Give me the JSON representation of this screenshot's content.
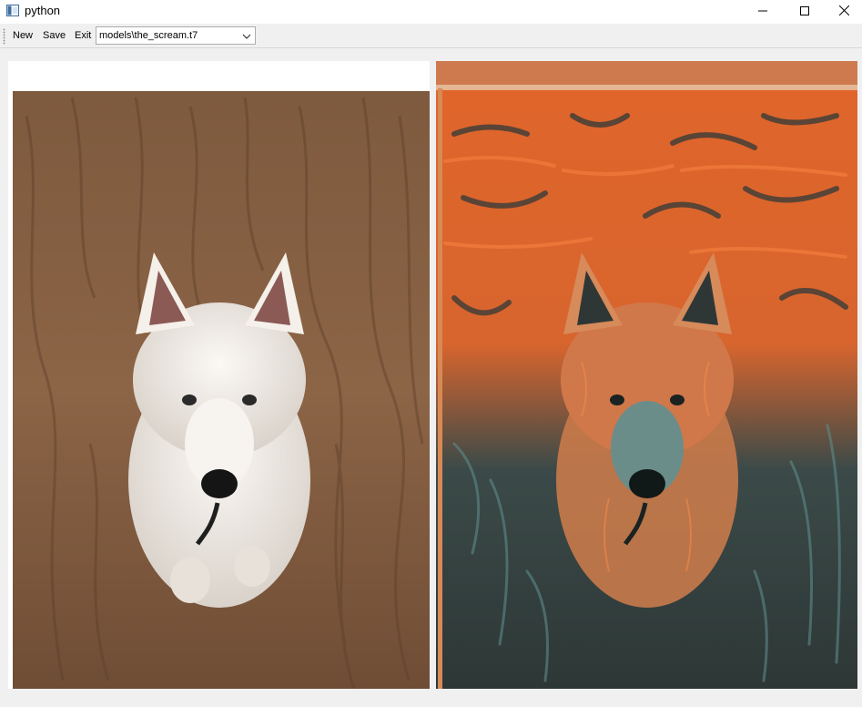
{
  "window": {
    "title": "python",
    "icon": "python-app-icon",
    "controls": [
      "minimize-icon",
      "maximize-icon",
      "close-icon"
    ]
  },
  "toolbar": {
    "new_label": "New",
    "save_label": "Save",
    "exit_label": "Exit",
    "model_select": {
      "selected": "models\\the_scream.t7"
    }
  },
  "images": {
    "content": {
      "description_icon": "dog-photo",
      "colors": {
        "sand": "#8a6142",
        "sand_dark": "#6e4a30",
        "fur": "#f2ede8"
      }
    },
    "stylized": {
      "description_icon": "stylized-dog-image",
      "colors": {
        "orange": "#e0652a",
        "dark": "#2f3a3a",
        "teal": "#5d8a8a"
      }
    }
  }
}
